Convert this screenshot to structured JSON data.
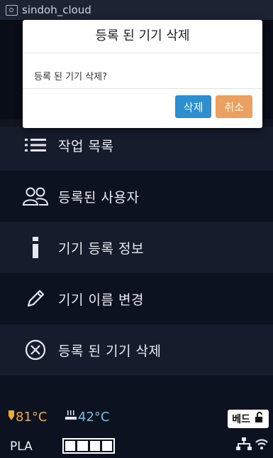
{
  "status_bar": {
    "title": "sindoh_cloud"
  },
  "menu": {
    "items": [
      {
        "label": "작업 목록",
        "icon": "list-icon"
      },
      {
        "label": "등록된 사용자",
        "icon": "users-icon"
      },
      {
        "label": "기기 등록 정보",
        "icon": "info-icon"
      },
      {
        "label": "기기 이름 변경",
        "icon": "pencil-icon"
      },
      {
        "label": "등록 된 기기 삭제",
        "icon": "circle-x-icon"
      }
    ]
  },
  "dialog": {
    "title": "등록 된 기기 삭제",
    "message": "등록 된 기기 삭제?",
    "confirm_label": "삭제",
    "cancel_label": "취소"
  },
  "bottom": {
    "nozzle_temp": "81°C",
    "bed_temp": "42°C",
    "bed_button": "베드",
    "material": "PLA",
    "filament_level": 1.0
  },
  "colors": {
    "accent_ok": "#2d8ed0",
    "accent_cancel": "#e9a061",
    "nozzle": "#f2a93b",
    "bed": "#6fc0e6"
  }
}
